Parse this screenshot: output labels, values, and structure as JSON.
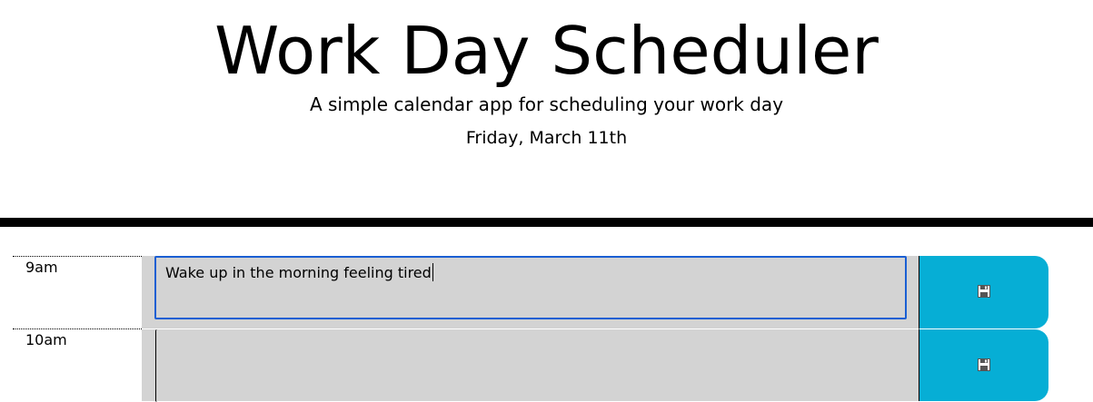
{
  "header": {
    "title": "Work Day Scheduler",
    "subtitle": "A simple calendar app for scheduling your work day",
    "current_day": "Friday, March 11th"
  },
  "colors": {
    "divider": "#000000",
    "block_bg": "#d3d3d3",
    "save_button": "#06aed5",
    "focus_border": "#1a5fd3"
  },
  "timeblocks": [
    {
      "hour": "9am",
      "text": "Wake up in the morning feeling tired",
      "focused": true,
      "save_icon": "save-icon"
    },
    {
      "hour": "10am",
      "text": "",
      "focused": false,
      "save_icon": "save-icon"
    }
  ]
}
